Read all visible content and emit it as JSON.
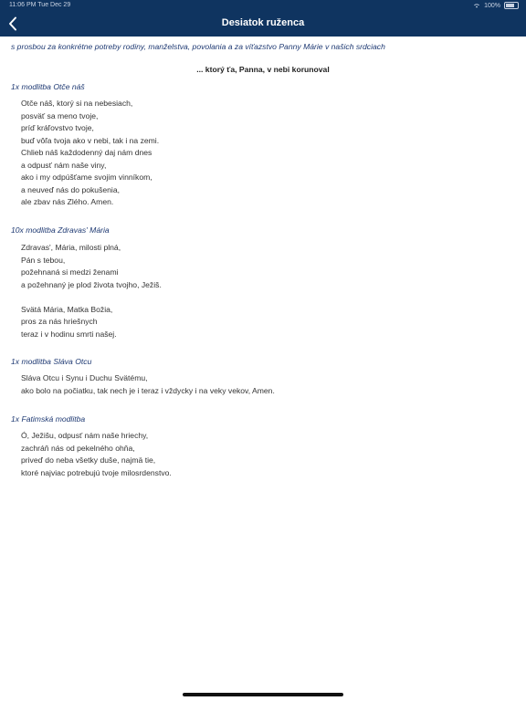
{
  "status_bar": {
    "time": "11:06 PM",
    "date": "Tue Dec 29",
    "battery": "100%"
  },
  "nav": {
    "title": "Desiatok ruženca",
    "back_icon": "chevron-left-icon"
  },
  "intro": "s prosbou za konkrétne potreby rodiny, manželstva, povolania a za víťazstvo Panny Márie v našich srdciach",
  "mystery": "... ktorý ťa, Panna, v nebi korunoval",
  "sections": [
    {
      "title": "1x modlitba Otče náš",
      "lines": [
        "Otče náš, ktorý si na nebesiach,",
        "posväť sa meno tvoje,",
        "príď kráľovstvo tvoje,",
        "buď vôľa tvoja ako v nebi, tak i na zemi.",
        "Chlieb náš každodenný daj nám dnes",
        "a odpusť nám naše viny,",
        "ako i my odpúšťame svojim vinníkom,",
        "a neuveď nás do pokušenia,",
        "ale zbav nás Zlého. Amen."
      ]
    },
    {
      "title": "10x modlitba Zdravas' Mária",
      "lines": [
        "Zdravas', Mária, milosti plná,",
        "Pán s tebou,",
        "požehnaná si medzi ženami",
        "a požehnaný je plod života tvojho, Ježiš."
      ],
      "lines2": [
        "Svätá Mária, Matka Božia,",
        "pros za nás hriešnych",
        "teraz i v hodinu smrti našej."
      ]
    },
    {
      "title": "1x modlitba Sláva Otcu",
      "lines": [
        "Sláva Otcu i Synu i Duchu Svätému,",
        "ako bolo na počiatku, tak nech je i teraz i vždycky i na veky vekov, Amen."
      ]
    },
    {
      "title": "1x Fatimská modlitba",
      "lines": [
        "Ó, Ježišu, odpusť nám naše hriechy,",
        "zachráň nás od pekelného ohňa,",
        "priveď do neba všetky duše, najmä tie,",
        "ktoré najviac potrebujú tvoje milosrdenstvo."
      ]
    }
  ],
  "colors": {
    "nav_background": "#0f3460",
    "section_title": "#1f3a73",
    "body_text": "#333333"
  }
}
